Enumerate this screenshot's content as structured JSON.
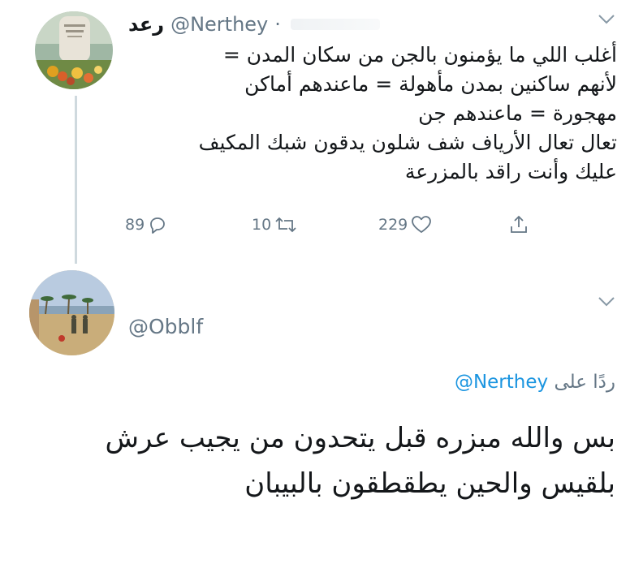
{
  "tweet": {
    "display_name": "رعد",
    "handle": "@Nerthey",
    "separator": "·",
    "lines": [
      "أغلب اللي ما يؤمنون بالجن من سكان المدن =",
      "لأنهم ساكنين بمدن مأهولة = ماعندهم أماكن",
      "مهجورة = ماعندهم جن",
      "تعال تعال الأرياف شف شلون يدقون شبك المكيف",
      "عليك وأنت راقد بالمزرعة"
    ],
    "actions": {
      "reply_count": "89",
      "retweet_count": "10",
      "like_count": "229"
    },
    "icons": {
      "reply": "reply-icon",
      "retweet": "retweet-icon",
      "like": "heart-icon",
      "share": "share-icon",
      "menu": "chevron-down-icon"
    }
  },
  "reply": {
    "handle": "@Obblf",
    "replying_prefix": "ردًا على",
    "replying_to": "@Nerthey",
    "lines": [
      "بس والله مبزره قبل يتحدون من يجيب عرش",
      "بلقيس والحين يطقطقون بالبيبان"
    ]
  },
  "colors": {
    "text": "#14171a",
    "secondary": "#657786",
    "link": "#1b95e0",
    "thread_line": "#cfd9de"
  }
}
